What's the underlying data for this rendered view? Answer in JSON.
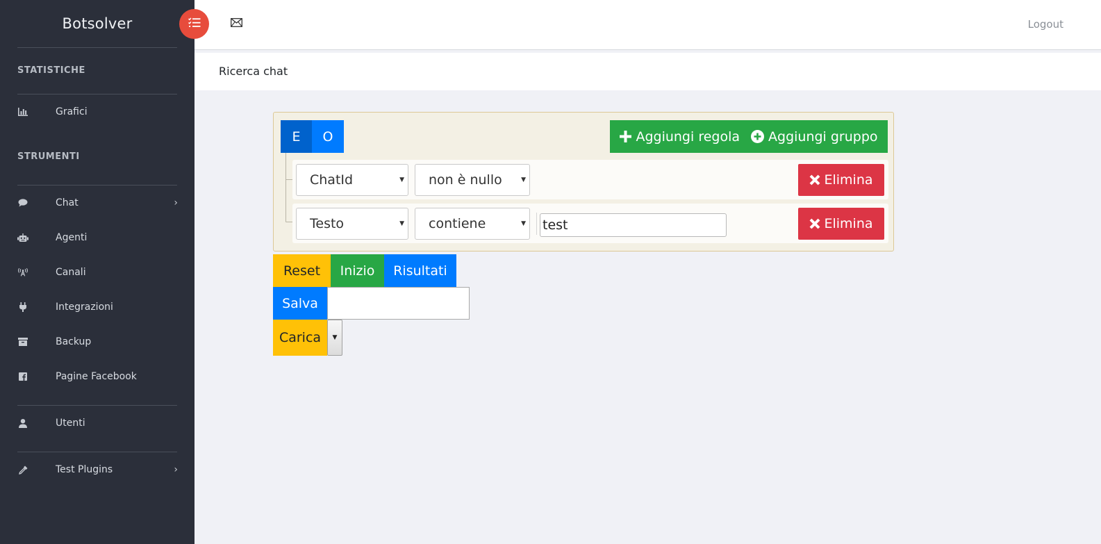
{
  "app": {
    "brand": "Botsolver"
  },
  "sidebar": {
    "sections": [
      {
        "title": "STATISTICHE"
      },
      {
        "title": "STRUMENTI"
      }
    ],
    "items": [
      {
        "label": "Grafici",
        "icon": "bar-chart-icon"
      },
      {
        "label": "Chat",
        "icon": "chat-bubble-icon",
        "has_submenu": true
      },
      {
        "label": "Agenti",
        "icon": "robot-icon"
      },
      {
        "label": "Canali",
        "icon": "broadcast-icon"
      },
      {
        "label": "Integrazioni",
        "icon": "plug-icon"
      },
      {
        "label": "Backup",
        "icon": "archive-icon"
      },
      {
        "label": "Pagine Facebook",
        "icon": "facebook-icon"
      },
      {
        "label": "Utenti",
        "icon": "user-icon"
      },
      {
        "label": "Test Plugins",
        "icon": "eyedropper-icon",
        "has_submenu": true
      }
    ]
  },
  "topbar": {
    "logout_label": "Logout",
    "mail_icon": "envelope-icon",
    "menu_toggle_icon": "list-check-icon"
  },
  "page": {
    "title": "Ricerca chat"
  },
  "query_builder": {
    "conditions": {
      "and_label": "E",
      "or_label": "O",
      "selected": "E"
    },
    "add_rule_label": "Aggiungi regola",
    "add_group_label": "Aggiungi gruppo",
    "rules": [
      {
        "field": "ChatId",
        "operator": "non è nullo",
        "value": null,
        "delete_label": "Elimina"
      },
      {
        "field": "Testo",
        "operator": "contiene",
        "value": "test",
        "delete_label": "Elimina"
      }
    ]
  },
  "actions": {
    "reset_label": "Reset",
    "start_label": "Inizio",
    "results_label": "Risultati",
    "save_label": "Salva",
    "save_name_value": "",
    "load_label": "Carica",
    "load_selected": ""
  },
  "colors": {
    "sidebar_bg": "#2b2f3a",
    "accent_red": "#e74c3c",
    "primary": "#007bff",
    "success": "#28a745",
    "warning": "#ffc107",
    "danger": "#dc3545"
  }
}
